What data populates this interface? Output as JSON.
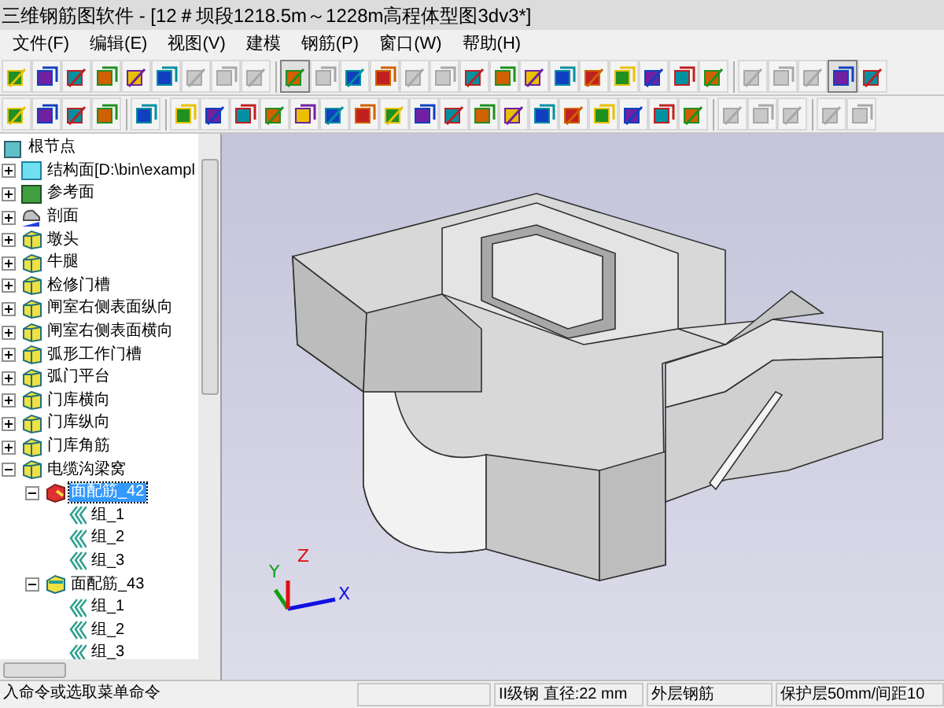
{
  "window": {
    "title": "三维钢筋图软件 - [12＃坝段1218.5m～1228m高程体型图3dv3*]"
  },
  "menu": [
    "文件(F)",
    "编辑(E)",
    "视图(V)",
    "建模",
    "钢筋(P)",
    "窗口(W)",
    "帮助(H)"
  ],
  "toolbar_1": [
    {
      "kind": "tool",
      "disabled": false,
      "pressed": false
    },
    {
      "kind": "tool",
      "disabled": false,
      "pressed": false
    },
    {
      "kind": "tool",
      "disabled": false,
      "pressed": false
    },
    {
      "kind": "tool",
      "disabled": false,
      "pressed": false
    },
    {
      "kind": "tool",
      "disabled": false,
      "pressed": false
    },
    {
      "kind": "tool",
      "disabled": false,
      "pressed": false
    },
    {
      "kind": "tool",
      "disabled": true,
      "pressed": false
    },
    {
      "kind": "tool",
      "disabled": true,
      "pressed": false
    },
    {
      "kind": "tool",
      "disabled": true,
      "pressed": false
    },
    {
      "kind": "separator"
    },
    {
      "kind": "tool",
      "disabled": false,
      "pressed": true
    },
    {
      "kind": "tool",
      "disabled": true,
      "pressed": false
    },
    {
      "kind": "tool",
      "disabled": false,
      "pressed": false
    },
    {
      "kind": "tool",
      "disabled": false,
      "pressed": false
    },
    {
      "kind": "tool",
      "disabled": true,
      "pressed": false
    },
    {
      "kind": "tool",
      "disabled": true,
      "pressed": false
    },
    {
      "kind": "tool",
      "disabled": false,
      "pressed": false
    },
    {
      "kind": "tool",
      "disabled": false,
      "pressed": false
    },
    {
      "kind": "tool",
      "disabled": false,
      "pressed": false
    },
    {
      "kind": "tool",
      "disabled": false,
      "pressed": false
    },
    {
      "kind": "tool",
      "disabled": false,
      "pressed": false
    },
    {
      "kind": "tool",
      "disabled": false,
      "pressed": false
    },
    {
      "kind": "tool",
      "disabled": false,
      "pressed": false
    },
    {
      "kind": "tool",
      "disabled": false,
      "pressed": false
    },
    {
      "kind": "tool",
      "disabled": false,
      "pressed": false
    },
    {
      "kind": "separator"
    },
    {
      "kind": "tool",
      "disabled": true,
      "pressed": false
    },
    {
      "kind": "tool",
      "disabled": true,
      "pressed": false
    },
    {
      "kind": "tool",
      "disabled": true,
      "pressed": false
    },
    {
      "kind": "tool",
      "disabled": false,
      "pressed": true
    },
    {
      "kind": "tool",
      "disabled": false,
      "pressed": false
    }
  ],
  "toolbar_2": [
    {
      "kind": "tool",
      "disabled": false
    },
    {
      "kind": "tool",
      "disabled": false
    },
    {
      "kind": "tool",
      "disabled": false
    },
    {
      "kind": "tool",
      "disabled": false
    },
    {
      "kind": "separator"
    },
    {
      "kind": "tool",
      "disabled": false
    },
    {
      "kind": "separator"
    },
    {
      "kind": "tool",
      "disabled": false
    },
    {
      "kind": "tool",
      "disabled": false
    },
    {
      "kind": "tool",
      "disabled": false
    },
    {
      "kind": "tool",
      "disabled": false
    },
    {
      "kind": "tool",
      "disabled": false
    },
    {
      "kind": "tool",
      "disabled": false
    },
    {
      "kind": "tool",
      "disabled": false
    },
    {
      "kind": "tool",
      "disabled": false
    },
    {
      "kind": "tool",
      "disabled": false
    },
    {
      "kind": "tool",
      "disabled": false
    },
    {
      "kind": "tool",
      "disabled": false
    },
    {
      "kind": "tool",
      "disabled": false
    },
    {
      "kind": "tool",
      "disabled": false
    },
    {
      "kind": "tool",
      "disabled": false
    },
    {
      "kind": "tool",
      "disabled": false
    },
    {
      "kind": "tool",
      "disabled": false
    },
    {
      "kind": "tool",
      "disabled": false
    },
    {
      "kind": "tool",
      "disabled": false
    },
    {
      "kind": "separator"
    },
    {
      "kind": "tool",
      "disabled": true
    },
    {
      "kind": "tool",
      "disabled": true
    },
    {
      "kind": "tool",
      "disabled": true
    },
    {
      "kind": "separator"
    },
    {
      "kind": "tool",
      "disabled": true
    },
    {
      "kind": "tool",
      "disabled": true
    }
  ],
  "tree": {
    "label": "根节点",
    "kind": "root",
    "selected": false,
    "children": [
      {
        "label": "结构面[D:\\bin\\exampl",
        "kind": "plane",
        "expanded": false,
        "selected": false
      },
      {
        "label": "参考面",
        "kind": "reference",
        "expanded": false,
        "selected": false
      },
      {
        "label": "剖面",
        "kind": "section",
        "expanded": false,
        "selected": false
      },
      {
        "label": "墩头",
        "kind": "part",
        "expanded": false,
        "selected": false
      },
      {
        "label": "牛腿",
        "kind": "part",
        "expanded": false,
        "selected": false
      },
      {
        "label": "检修门槽",
        "kind": "part",
        "expanded": false,
        "selected": false
      },
      {
        "label": "闸室右侧表面纵向",
        "kind": "part",
        "expanded": false,
        "selected": false
      },
      {
        "label": "闸室右侧表面横向",
        "kind": "part",
        "expanded": false,
        "selected": false
      },
      {
        "label": "弧形工作门槽",
        "kind": "part",
        "expanded": false,
        "selected": false
      },
      {
        "label": "弧门平台",
        "kind": "part",
        "expanded": false,
        "selected": false
      },
      {
        "label": "门库横向",
        "kind": "part",
        "expanded": false,
        "selected": false
      },
      {
        "label": "门库纵向",
        "kind": "part",
        "expanded": false,
        "selected": false
      },
      {
        "label": "门库角筋",
        "kind": "part",
        "expanded": false,
        "selected": false
      },
      {
        "label": "电缆沟梁窝",
        "kind": "part",
        "expanded": true,
        "selected": false,
        "children": [
          {
            "label": "面配筋_42",
            "kind": "rebar_active",
            "expanded": true,
            "selected": true,
            "children": [
              {
                "label": "组_1",
                "kind": "group",
                "selected": false
              },
              {
                "label": "组_2",
                "kind": "group",
                "selected": false
              },
              {
                "label": "组_3",
                "kind": "group",
                "selected": false
              }
            ]
          },
          {
            "label": "面配筋_43",
            "kind": "rebar",
            "expanded": true,
            "selected": false,
            "children": [
              {
                "label": "组_1",
                "kind": "group",
                "selected": false
              },
              {
                "label": "组_2",
                "kind": "group",
                "selected": false
              },
              {
                "label": "组_3",
                "kind": "group",
                "selected": false
              }
            ]
          }
        ]
      }
    ]
  },
  "viewport": {
    "axes": [
      "X",
      "Y",
      "Z"
    ]
  },
  "status_bar": [
    "入命令或选取菜单命令",
    "II级钢  直径:22 mm",
    "外层钢筋",
    "保护层50mm/间距10"
  ]
}
